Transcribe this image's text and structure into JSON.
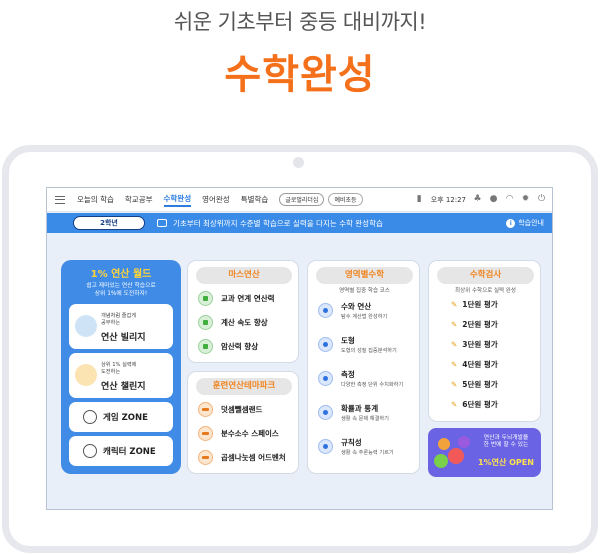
{
  "promo": {
    "subtitle": "쉬운 기초부터 중등 대비까지!",
    "title": "수학완성",
    "accent": "#f5701a"
  },
  "topnav": {
    "items": [
      "오늘의 학습",
      "학교공부",
      "수학완성",
      "영어완성",
      "특별학습"
    ],
    "active": "수학완성",
    "pills": [
      "글로벌리더십",
      "예비초등"
    ],
    "time": "오후 12:27",
    "icons": [
      "battery-icon",
      "bell-icon",
      "user-icon",
      "wifi-icon",
      "gear-icon",
      "power-icon"
    ]
  },
  "bluebar": {
    "grade": "2학년",
    "message": "기초부터 최상위까지 수준별 학습으로 실력을 다지는 수학 완성학습",
    "guide": "학습안내",
    "color": "#3a8be8"
  },
  "left_card": {
    "title": "1% 연산 월드",
    "desc_line1": "쉽고 재미있는 연산 학습으로",
    "desc_line2": "상위 1%에 도전하자!",
    "items": [
      {
        "small1": "개념처럼 즐겁게",
        "small2": "공부하는",
        "big": "연산 빌리지"
      },
      {
        "small1": "상위 1% 실력에",
        "small2": "도전하는",
        "big": "연산 챌린지"
      }
    ],
    "zones": [
      "게임 ZONE",
      "캐릭터 ZONE"
    ]
  },
  "math_calc": {
    "title": "마스연산",
    "items": [
      "교과 연계 연산력",
      "계산 속도 향상",
      "암산력 향상"
    ]
  },
  "training": {
    "title": "훈련연산테마파크",
    "items": [
      "덧셈뺄셈랜드",
      "분수소수 스페이스",
      "곱셈나눗셈 어드벤처"
    ]
  },
  "area_math": {
    "title": "영역별수학",
    "subtitle": "영역별 집중 학습 코스",
    "items": [
      {
        "label": "수와 연산",
        "sub": "탐수 계산법 완성하기"
      },
      {
        "label": "도형",
        "sub": "도형의 성질 집중분석하기"
      },
      {
        "label": "측정",
        "sub": "다양한 측정 단위 수치화하기"
      },
      {
        "label": "확률과 통계",
        "sub": "생활 속 문제 해결하기"
      },
      {
        "label": "규칙성",
        "sub": "생활 속 추론능력 기르기"
      }
    ]
  },
  "math_test": {
    "title": "수학검사",
    "subtitle": "최상위 수학으로 실력 완성",
    "items": [
      "1단원 평가",
      "2단원 평가",
      "3단원 평가",
      "4단원 평가",
      "5단원 평가",
      "6단원 평가"
    ]
  },
  "open_banner": {
    "line1": "연산과 두뇌개발을",
    "line2": "한 번에 할 수 있는",
    "big": "1%연산 OPEN"
  }
}
